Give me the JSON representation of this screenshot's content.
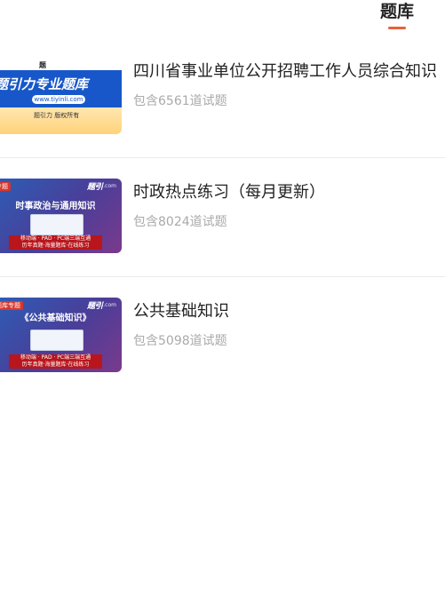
{
  "header": {
    "active_tab": "题库"
  },
  "items": [
    {
      "title": "四川省事业单位公开招聘工作人员综合知识",
      "subtitle": "包含6561道试题",
      "thumb": {
        "main": "题引力专业题库",
        "url": "www.tiyinli.com",
        "footer": "题引力 版权所有"
      }
    },
    {
      "title": "时政热点练习（每月更新）",
      "subtitle": "包含8024道试题",
      "thumb": {
        "tag": "专题",
        "site": "tiyinli.com",
        "name": "时事政治与通用知识",
        "line1": "移动端 · PAD · PC端三端互通",
        "line2": "历年真题·海量题库·在线练习"
      }
    },
    {
      "title": "公共基础知识",
      "subtitle": "包含5098道试题",
      "thumb": {
        "tag": "题库专题",
        "site": "tiyinli.com",
        "name": "《公共基础知识》",
        "line1": "移动端 · PAD · PC端三端互通",
        "line2": "历年真题·海量题库·在线练习"
      }
    }
  ]
}
